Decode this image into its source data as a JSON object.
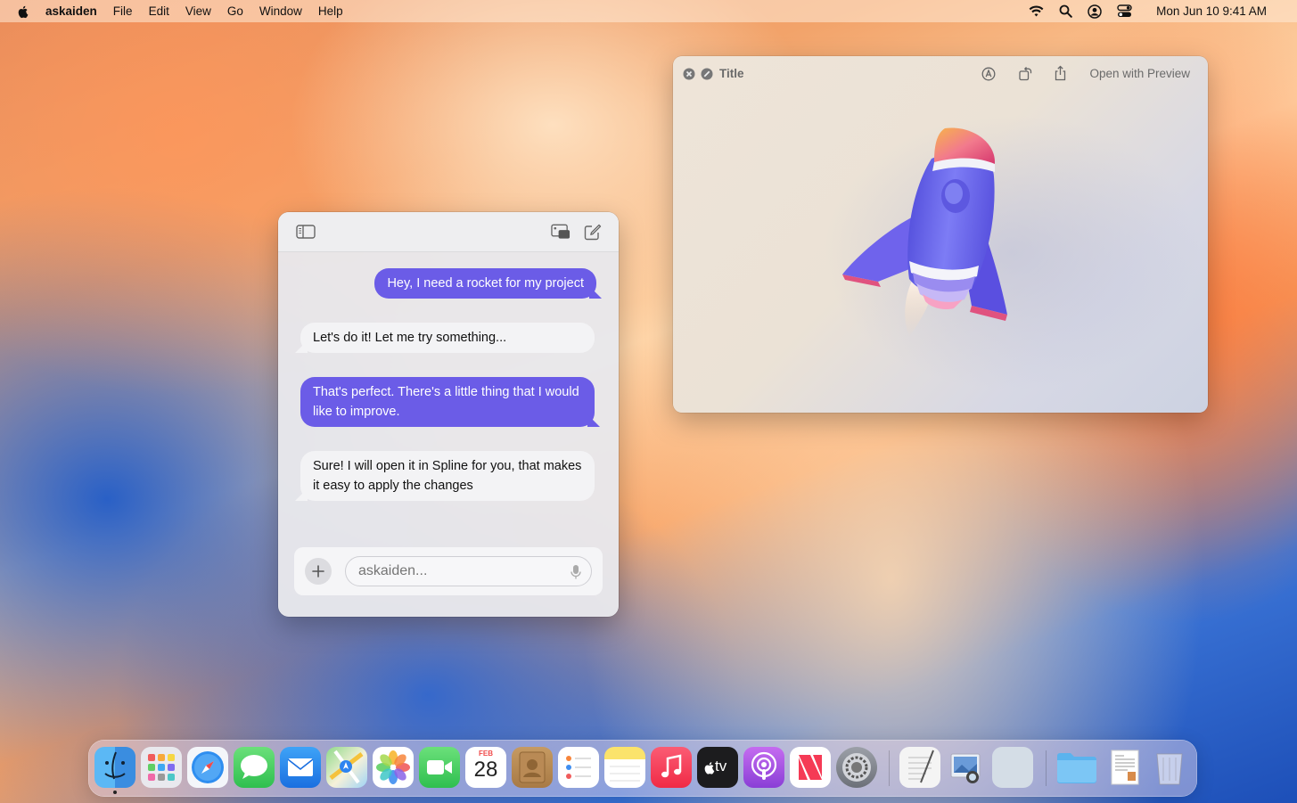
{
  "menubar": {
    "app_name": "askaiden",
    "items": [
      "File",
      "Edit",
      "View",
      "Go",
      "Window",
      "Help"
    ],
    "clock": "Mon Jun 10  9:41 AM",
    "status_icons": [
      "wifi-icon",
      "search-icon",
      "user-icon",
      "control-center-icon"
    ]
  },
  "chat": {
    "messages": [
      {
        "from": "user",
        "text": "Hey, I need a rocket for my project"
      },
      {
        "from": "assistant",
        "text": "Let's do it! Let me try something..."
      },
      {
        "from": "user",
        "text": "That's perfect. There's a little thing that I would like to improve."
      },
      {
        "from": "assistant",
        "text": "Sure! I will open it in Spline for you, that makes it easy to apply the changes"
      }
    ],
    "input_placeholder": "askaiden...",
    "toolbar_icons": [
      "sidebar-icon",
      "picture-in-picture-icon",
      "compose-icon"
    ]
  },
  "preview": {
    "title": "Title",
    "open_label": "Open with Preview",
    "toolbar_icons": [
      "markup-icon",
      "rotate-icon",
      "share-icon"
    ]
  },
  "dock": {
    "apps": [
      "Finder",
      "Launchpad",
      "Safari",
      "Messages",
      "Mail",
      "Maps",
      "Photos",
      "FaceTime",
      "Calendar",
      "Contacts",
      "Reminders",
      "Notes",
      "Music",
      "TV",
      "Podcasts",
      "News",
      "System Settings",
      "TextEdit",
      "Preview",
      "Blank",
      "Folder",
      "Document",
      "Trash"
    ],
    "calendar_month": "FEB",
    "calendar_day": "28",
    "tv_label": "tv"
  }
}
